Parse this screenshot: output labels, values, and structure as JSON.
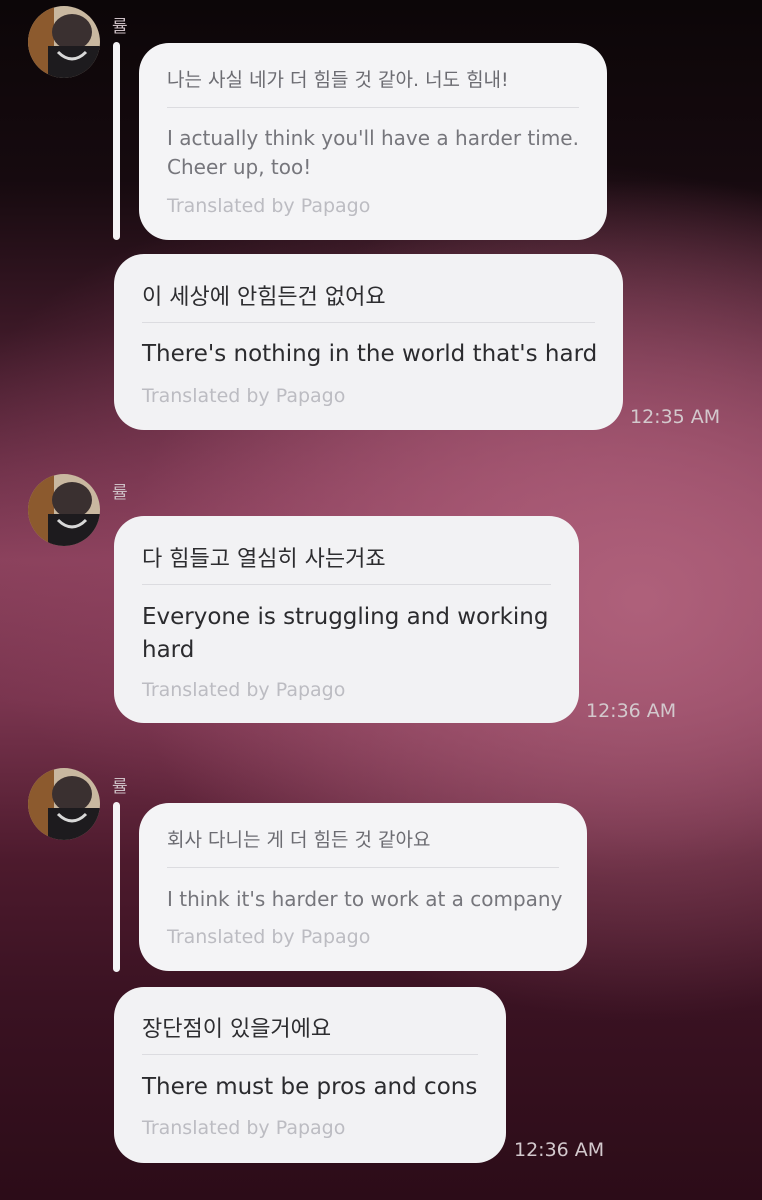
{
  "conversation": {
    "groups": [
      {
        "sender": "률",
        "quoted": {
          "original": "나는 사실 네가 더 힘들 것 같아. 너도 힘내!",
          "translation": "I actually think you'll have a harder time. Cheer up, too!",
          "credit": "Translated by Papago"
        },
        "message": {
          "original": "이 세상에 안힘든건 없어요",
          "translation": "There's nothing in the world that's hard",
          "credit": "Translated by Papago"
        },
        "time": "12:35 AM"
      },
      {
        "sender": "률",
        "message": {
          "original": "다 힘들고 열심히 사는거죠",
          "translation": "Everyone is struggling and working hard",
          "credit": "Translated by Papago"
        },
        "time": "12:36 AM"
      },
      {
        "sender": "률",
        "quoted": {
          "original": "회사 다니는 게 더 힘든 것 같아요",
          "translation": "I think it's harder to work at a company",
          "credit": "Translated by Papago"
        },
        "message": {
          "original": "장단점이 있을거에요",
          "translation": "There must be pros and cons",
          "credit": "Translated by Papago"
        },
        "time": "12:36 AM"
      }
    ]
  }
}
